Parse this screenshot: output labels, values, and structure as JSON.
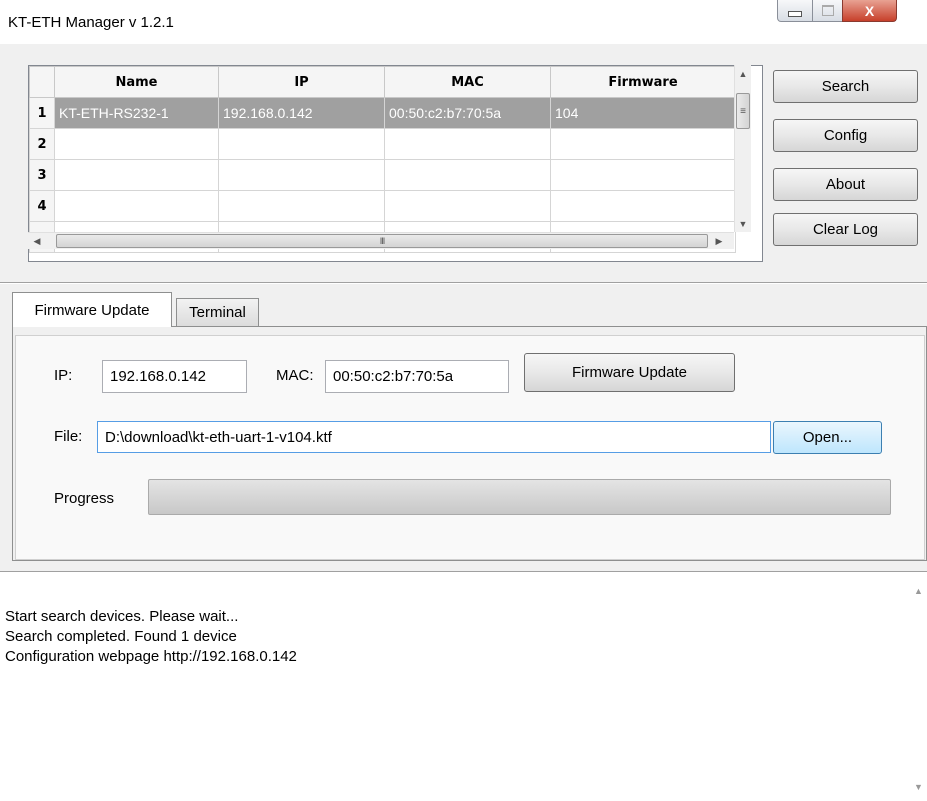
{
  "window": {
    "title": "KT-ETH Manager v 1.2.1",
    "controls": {
      "close_label": "X"
    }
  },
  "device_table": {
    "columns": [
      "Name",
      "IP",
      "MAC",
      "Firmware"
    ],
    "row_numbers": [
      "1",
      "2",
      "3",
      "4",
      ""
    ],
    "rows": [
      {
        "name": "KT-ETH-RS232-1",
        "ip": "192.168.0.142",
        "mac": "00:50:c2:b7:70:5a",
        "firmware": "104"
      },
      {
        "name": "",
        "ip": "",
        "mac": "",
        "firmware": ""
      },
      {
        "name": "",
        "ip": "",
        "mac": "",
        "firmware": ""
      },
      {
        "name": "",
        "ip": "",
        "mac": "",
        "firmware": ""
      },
      {
        "name": "",
        "ip": "",
        "mac": "",
        "firmware": ""
      }
    ],
    "hscroll_thumb_label": "III",
    "vscroll_thumb_label": "≡"
  },
  "side_buttons": {
    "search": "Search",
    "config": "Config",
    "about": "About",
    "clear_log": "Clear Log"
  },
  "tabs": [
    {
      "label": "Firmware Update",
      "active": true
    },
    {
      "label": "Terminal",
      "active": false
    }
  ],
  "firmware_update": {
    "ip_label": "IP:",
    "ip_value": "192.168.0.142",
    "mac_label": "MAC:",
    "mac_value": "00:50:c2:b7:70:5a",
    "update_button": "Firmware Update",
    "file_label": "File:",
    "file_value": "D:\\download\\kt-eth-uart-1-v104.ktf",
    "open_button": "Open...",
    "progress_label": "Progress",
    "progress_percent": 0
  },
  "log": {
    "lines": [
      "Start search devices. Please wait...",
      "Search completed. Found 1 device",
      "Configuration webpage http://192.168.0.142"
    ]
  },
  "colors": {
    "selected_row": "#a0a0a0",
    "close_button": "#c7402b"
  }
}
